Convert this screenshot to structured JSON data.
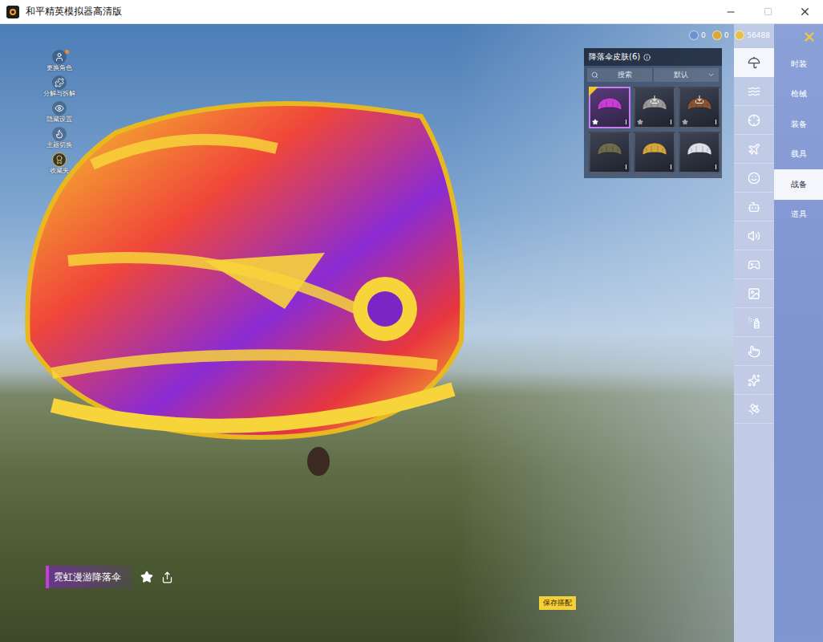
{
  "window": {
    "title": "和平精英模拟器高清版",
    "maximize_disabled": true
  },
  "hud_tools": [
    {
      "label": "更换角色",
      "badge": true
    },
    {
      "label": "分解与拆解",
      "badge": false
    },
    {
      "label": "隐藏设置",
      "badge": false
    },
    {
      "label": "主题切换",
      "badge": false
    },
    {
      "label": "收藏夹",
      "badge": false
    }
  ],
  "currency": [
    {
      "value": "0",
      "color": "#6f8fd0"
    },
    {
      "value": "0",
      "color": "#d9a73a"
    },
    {
      "value": "56488",
      "color": "#e8c14a"
    }
  ],
  "skin_panel": {
    "title": "降落伞皮肤(6)",
    "search_placeholder": "搜索",
    "sort": "默认",
    "items": [
      {
        "kind": "owned",
        "selected": true,
        "new": true,
        "starred": true,
        "color": "#c93fd6"
      },
      {
        "kind": "download",
        "selected": false,
        "new": false,
        "starred": true,
        "color": "#9a9a9a"
      },
      {
        "kind": "download",
        "selected": false,
        "new": false,
        "starred": true,
        "color": "#8a5434"
      },
      {
        "kind": "owned",
        "selected": false,
        "new": false,
        "starred": false,
        "color": "#6d6b4c"
      },
      {
        "kind": "owned",
        "selected": false,
        "new": false,
        "starred": false,
        "color": "#d3a640"
      },
      {
        "kind": "owned",
        "selected": false,
        "new": false,
        "starred": false,
        "color": "#e0e0ea"
      }
    ]
  },
  "categories": [
    {
      "selected": true
    },
    {
      "selected": false
    },
    {
      "selected": false
    },
    {
      "selected": false
    },
    {
      "selected": false
    },
    {
      "selected": false
    },
    {
      "selected": false
    },
    {
      "selected": false
    },
    {
      "selected": false
    },
    {
      "selected": false
    },
    {
      "selected": false
    },
    {
      "selected": false
    },
    {
      "selected": false
    }
  ],
  "tabs": [
    {
      "label": "时装",
      "selected": false
    },
    {
      "label": "枪械",
      "selected": false
    },
    {
      "label": "装备",
      "selected": false
    },
    {
      "label": "载具",
      "selected": false
    },
    {
      "label": "战备",
      "selected": true
    },
    {
      "label": "道具",
      "selected": false
    }
  ],
  "item": {
    "name": "霓虹漫游降落伞",
    "favorited": false
  },
  "save_button": "保存搭配"
}
